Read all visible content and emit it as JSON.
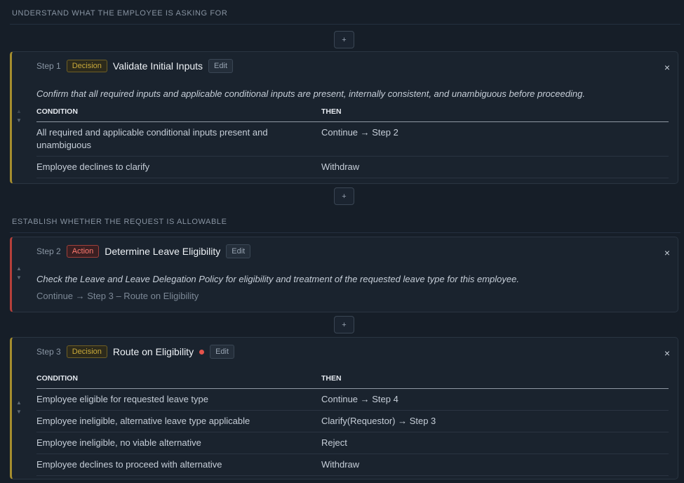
{
  "sections": [
    {
      "header": "UNDERSTAND WHAT THE EMPLOYEE IS ASKING FOR"
    },
    {
      "header": "ESTABLISH WHETHER THE REQUEST IS ALLOWABLE"
    }
  ],
  "add_label": "+",
  "close_label": "×",
  "reorder": {
    "up": "▲",
    "down": "▼"
  },
  "table_headers": {
    "condition": "CONDITION",
    "then": "THEN"
  },
  "steps": [
    {
      "step": "Step 1",
      "type": "Decision",
      "title": "Validate Initial Inputs",
      "edit": "Edit",
      "description": "Confirm that all required inputs and applicable conditional inputs are present, internally consistent, and unambiguous before proceeding.",
      "rows": [
        {
          "condition": "All required and applicable conditional inputs present and unambiguous",
          "then": "Continue → Step 2"
        },
        {
          "condition": "Employee declines to clarify",
          "then": "Withdraw"
        }
      ]
    },
    {
      "step": "Step 2",
      "type": "Action",
      "title": "Determine Leave Eligibility",
      "edit": "Edit",
      "description": "Check the Leave and Leave Delegation Policy for eligibility and treatment of the requested leave type for this employee.",
      "next": "Continue → Step 3 – Route on Eligibility"
    },
    {
      "step": "Step 3",
      "type": "Decision",
      "title": "Route on Eligibility",
      "edit": "Edit",
      "rows": [
        {
          "condition": "Employee eligible for requested leave type",
          "then": "Continue → Step 4"
        },
        {
          "condition": "Employee ineligible, alternative leave type applicable",
          "then": "Clarify(Requestor) → Step 3"
        },
        {
          "condition": "Employee ineligible, no viable alternative",
          "then": "Reject"
        },
        {
          "condition": "Employee declines to proceed with alternative",
          "then": "Withdraw"
        }
      ]
    }
  ],
  "colors": {
    "decision": "#a58d2e",
    "action": "#b5403a",
    "unsaved_dot": "#e5534b"
  }
}
